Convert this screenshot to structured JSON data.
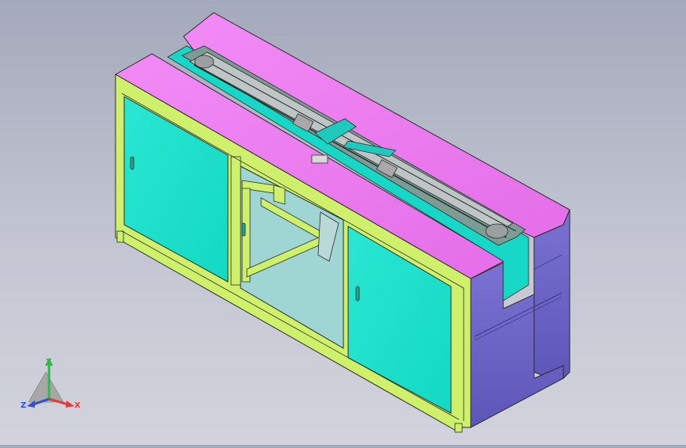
{
  "viewport": {
    "background_top": "#a4a9bb",
    "background_bottom": "#d2d3dc"
  },
  "colors": {
    "top": "#f07df5",
    "frame": "#cef06a",
    "door": "#1fe3cc",
    "side": "#6f67c9",
    "glass": "#9fd5d2",
    "conveyor_plate": "#a8a8a8",
    "outline": "#2b2b2b"
  },
  "triad": {
    "x_label": "X",
    "y_label": "Y",
    "z_label": "Z",
    "x_color": "#e23b3b",
    "y_color": "#2fb84a",
    "z_color": "#2e4fd9"
  }
}
